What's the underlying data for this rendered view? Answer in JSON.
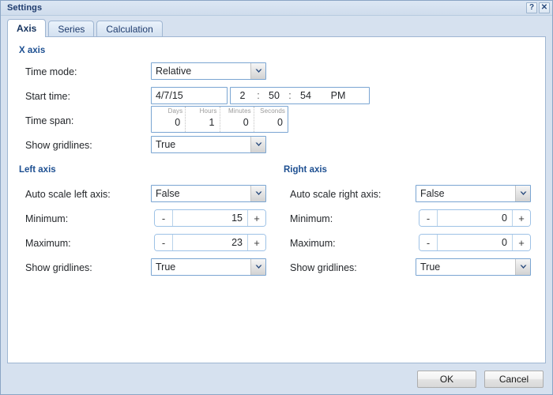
{
  "window": {
    "title": "Settings",
    "help_label": "?",
    "close_label": "✕"
  },
  "tabs": [
    {
      "label": "Axis",
      "active": true
    },
    {
      "label": "Series",
      "active": false
    },
    {
      "label": "Calculation",
      "active": false
    }
  ],
  "sections": {
    "x_axis": {
      "title": "X axis",
      "time_mode": {
        "label": "Time mode:",
        "value": "Relative"
      },
      "start_time": {
        "label": "Start time:",
        "date": "4/7/15",
        "hour": "2",
        "minute": "50",
        "second": "54",
        "meridiem": "PM",
        "separator": ":"
      },
      "time_span": {
        "label": "Time span:",
        "columns": [
          {
            "header": "Days",
            "value": "0"
          },
          {
            "header": "Hours",
            "value": "1"
          },
          {
            "header": "Minutes",
            "value": "0"
          },
          {
            "header": "Seconds",
            "value": "0"
          }
        ]
      },
      "show_gridlines": {
        "label": "Show gridlines:",
        "value": "True"
      }
    },
    "left_axis": {
      "title": "Left axis",
      "auto_scale": {
        "label": "Auto scale left axis:",
        "value": "False"
      },
      "minimum": {
        "label": "Minimum:",
        "value": "15"
      },
      "maximum": {
        "label": "Maximum:",
        "value": "23"
      },
      "show_gridlines": {
        "label": "Show gridlines:",
        "value": "True"
      }
    },
    "right_axis": {
      "title": "Right axis",
      "auto_scale": {
        "label": "Auto scale right axis:",
        "value": "False"
      },
      "minimum": {
        "label": "Minimum:",
        "value": "0"
      },
      "maximum": {
        "label": "Maximum:",
        "value": "0"
      },
      "show_gridlines": {
        "label": "Show gridlines:",
        "value": "True"
      }
    }
  },
  "stepper": {
    "decrement_label": "-",
    "increment_label": "+"
  },
  "footer": {
    "ok_label": "OK",
    "cancel_label": "Cancel"
  },
  "colors": {
    "window_chrome": "#d6e1ef",
    "section_heading": "#1d4f91",
    "title_text": "#1f3c6e",
    "field_border": "#7aa5d2"
  }
}
